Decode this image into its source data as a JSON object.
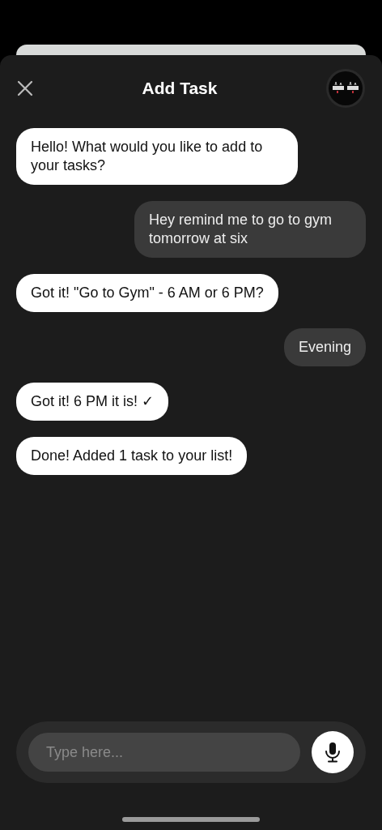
{
  "header": {
    "title": "Add Task"
  },
  "messages": [
    {
      "kind": "bot",
      "text": "Hello! What would you like to add to your tasks?"
    },
    {
      "kind": "user",
      "text": "Hey remind me to go to gym tomorrow at six"
    },
    {
      "kind": "bot",
      "text": "Got it! \"Go to Gym\" - 6 AM or 6 PM?"
    },
    {
      "kind": "user",
      "text": "Evening"
    },
    {
      "kind": "bot",
      "text": "Got it! 6 PM it is! ✓"
    },
    {
      "kind": "bot",
      "text": "Done! Added 1 task to your list!"
    }
  ],
  "composer": {
    "placeholder": "Type here..."
  }
}
